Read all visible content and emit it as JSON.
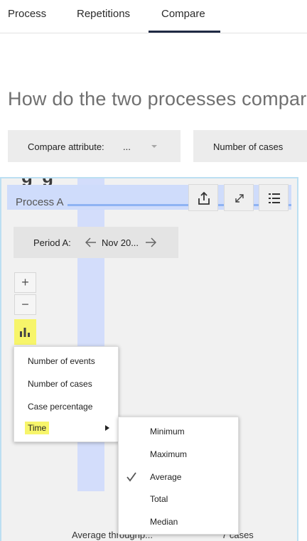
{
  "tabs": [
    {
      "label": "Process"
    },
    {
      "label": "Repetitions"
    },
    {
      "label": "Compare",
      "active": true
    }
  ],
  "heading": "How do the two processes compare",
  "compare_attribute": {
    "label": "Compare attribute:",
    "value": "..."
  },
  "metric_select": {
    "value": "Number of cases"
  },
  "panel": {
    "ghost_text": "g   g",
    "title": "Process A",
    "toolbar": {
      "share_icon": "share-icon",
      "expand_icon": "expand-icon",
      "list_icon": "list-icon"
    },
    "period": {
      "label": "Period A:",
      "value": "Nov 20..."
    },
    "zoom_in": "+",
    "zoom_out": "−",
    "chart_icon": "bar-chart-icon"
  },
  "menu": {
    "items": [
      {
        "label": "Number of events"
      },
      {
        "label": "Number of cases"
      },
      {
        "label": "Case percentage"
      },
      {
        "label": "Time",
        "has_submenu": true,
        "highlighted": true
      }
    ]
  },
  "submenu": {
    "items": [
      {
        "label": "Minimum"
      },
      {
        "label": "Maximum"
      },
      {
        "label": "Average",
        "checked": true
      },
      {
        "label": "Total"
      },
      {
        "label": "Median"
      }
    ]
  },
  "footer": {
    "left": "Average throughp...",
    "right": "7 cases"
  },
  "colors": {
    "highlight": "#f7f56a",
    "active_tab": "#1f2a44",
    "flow": "#d3ddfb",
    "panel_border": "#bcdff2"
  }
}
